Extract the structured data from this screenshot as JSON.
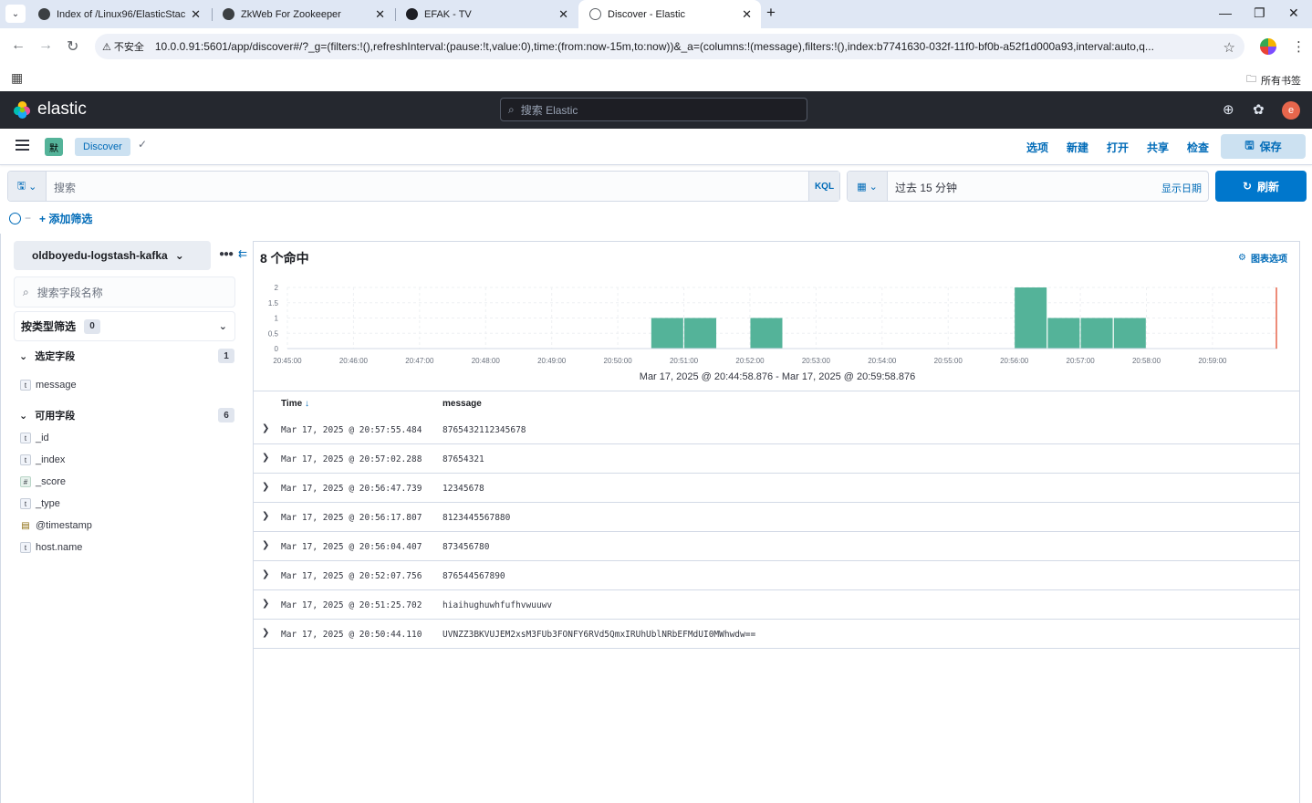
{
  "browser": {
    "tabs": [
      {
        "title": "Index of /Linux96/ElasticStac",
        "active": false
      },
      {
        "title": "ZkWeb For Zookeeper",
        "active": false
      },
      {
        "title": "EFAK - TV",
        "active": false
      },
      {
        "title": "Discover - Elastic",
        "active": true
      }
    ],
    "insecure_label": "不安全",
    "url": "10.0.0.91:5601/app/discover#/?_g=(filters:!(),refreshInterval:(pause:!t,value:0),time:(from:now-15m,to:now))&_a=(columns:!(message),filters:!(),index:b7741630-032f-11f0-bf0b-a52f1d000a93,interval:auto,q...",
    "all_bookmarks": "所有书签"
  },
  "kibana": {
    "brand": "elastic",
    "global_search_placeholder": "搜索 Elastic",
    "user_initial": "e",
    "space_initial": "默",
    "breadcrumb": "Discover",
    "top_nav": [
      "选项",
      "新建",
      "打开",
      "共享",
      "检查"
    ],
    "save_label": "保存",
    "query": {
      "placeholder": "搜索",
      "language": "KQL"
    },
    "time": {
      "range_label": "过去 15 分钟",
      "show_dates": "显示日期",
      "refresh_label": "刷新"
    },
    "add_filter": "+ 添加筛选"
  },
  "sidebar": {
    "index_pattern": "oldboyedu-logstash-kafka",
    "field_search_placeholder": "搜索字段名称",
    "type_filter_label": "按类型筛选",
    "type_filter_count": "0",
    "selected_label": "选定字段",
    "selected_count": "1",
    "selected_fields": [
      {
        "name": "message",
        "type": "t"
      }
    ],
    "available_label": "可用字段",
    "available_count": "6",
    "available_fields": [
      {
        "name": "_id",
        "type": "t"
      },
      {
        "name": "_index",
        "type": "t"
      },
      {
        "name": "_score",
        "type": "#"
      },
      {
        "name": "_type",
        "type": "t"
      },
      {
        "name": "@timestamp",
        "type": "date"
      },
      {
        "name": "host.name",
        "type": "t"
      }
    ]
  },
  "main": {
    "hits": "8 个命中",
    "chart_options": "图表选项",
    "range_caption": "Mar 17, 2025 @ 20:44:58.876 - Mar 17, 2025 @ 20:59:58.876",
    "columns": {
      "time": "Time",
      "message": "message"
    },
    "rows": [
      {
        "time": "Mar 17, 2025 @ 20:57:55.484",
        "message": "8765432112345678"
      },
      {
        "time": "Mar 17, 2025 @ 20:57:02.288",
        "message": "87654321"
      },
      {
        "time": "Mar 17, 2025 @ 20:56:47.739",
        "message": "12345678"
      },
      {
        "time": "Mar 17, 2025 @ 20:56:17.807",
        "message": "8123445567880"
      },
      {
        "time": "Mar 17, 2025 @ 20:56:04.407",
        "message": "873456780"
      },
      {
        "time": "Mar 17, 2025 @ 20:52:07.756",
        "message": "876544567890"
      },
      {
        "time": "Mar 17, 2025 @ 20:51:25.702",
        "message": "hiaihughuwhfufhvwuuwv"
      },
      {
        "time": "Mar 17, 2025 @ 20:50:44.110",
        "message": "UVNZZ3BKVUJEM2xsM3FUb3FONFY6RVd5QmxIRUhUblNRbEFMdUI0MWhwdw=="
      }
    ]
  },
  "chart_data": {
    "type": "bar",
    "x_start": "20:45:00",
    "x_end": "20:59:58.876",
    "bucket": "30s",
    "x_ticks": [
      "20:45:00",
      "20:46:00",
      "20:47:00",
      "20:48:00",
      "20:49:00",
      "20:50:00",
      "20:51:00",
      "20:52:00",
      "20:53:00",
      "20:54:00",
      "20:55:00",
      "20:56:00",
      "20:57:00",
      "20:58:00",
      "20:59:00"
    ],
    "y_ticks": [
      "0",
      "0.5",
      "1",
      "1.5",
      "2"
    ],
    "ylim": [
      0,
      2
    ],
    "bars": [
      {
        "start": "20:50:30",
        "count": 1
      },
      {
        "start": "20:51:00",
        "count": 1
      },
      {
        "start": "20:52:00",
        "count": 1
      },
      {
        "start": "20:56:00",
        "count": 2
      },
      {
        "start": "20:56:30",
        "count": 1
      },
      {
        "start": "20:57:00",
        "count": 1
      },
      {
        "start": "20:57:30",
        "count": 1
      }
    ],
    "now_marker": "20:59:58.876",
    "bar_color": "#54b399",
    "now_color": "#e7664c"
  }
}
